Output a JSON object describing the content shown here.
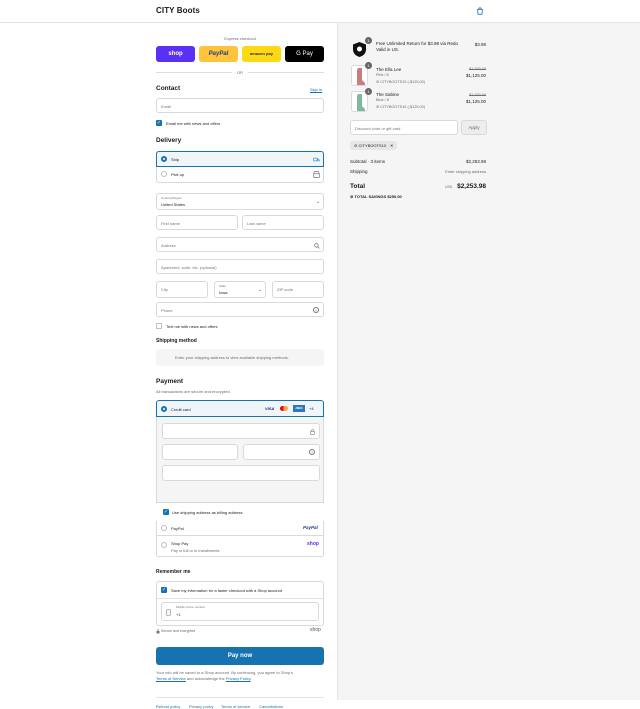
{
  "header": {
    "brand": "CITY Boots",
    "cart_icon": "shopping-bag-icon"
  },
  "express": {
    "title": "Express checkout",
    "buttons": [
      {
        "label": "shop",
        "color": "#5a31f4"
      },
      {
        "label": "PayPal",
        "color": "#ffc439"
      },
      {
        "label": "amazon pay",
        "color": "#ffd814"
      },
      {
        "label": "G Pay",
        "color": "#000000"
      }
    ],
    "or": "OR"
  },
  "contact": {
    "title": "Contact",
    "sign_in": "Sign in",
    "email_placeholder": "Email",
    "news_label": "Email me with news and offers"
  },
  "delivery": {
    "title": "Delivery",
    "options": [
      {
        "label": "Ship"
      },
      {
        "label": "Pick up"
      }
    ],
    "country_label": "Country/Region",
    "country_value": "United States",
    "first_name": "First name",
    "last_name": "Last name",
    "address": "Address",
    "apartment": "Apartment, suite, etc. (optional)",
    "city": "City",
    "state_label": "State",
    "state_value": "Iowa",
    "zip": "ZIP code",
    "phone": "Phone",
    "text_news": "Text me with news and offers"
  },
  "shipping_method": {
    "title": "Shipping method",
    "message": "Enter your shipping address to view available shipping methods."
  },
  "payment": {
    "title": "Payment",
    "subtitle": "All transactions are secure and encrypted.",
    "credit_card": "Credit card",
    "card_brands": [
      "VISA",
      "MC",
      "AMEX",
      "+4"
    ],
    "billing_label": "Use shipping address as billing address",
    "paypal_label": "PayPal",
    "paypal_logo": "PayPal",
    "shoppay_label": "Shop Pay",
    "shoppay_sub": "Pay in full or in installments",
    "shoppay_logo": "shop"
  },
  "remember": {
    "title": "Remember me",
    "save_label": "Save my information for a faster checkout with a Shop account",
    "mobile_label": "Mobile phone number",
    "mobile_value": "+1",
    "secure_label": "Secure and encrypted",
    "shop_logo": "shop"
  },
  "pay": {
    "button": "Pay now",
    "terms_1": "Your info will be saved to a Shop account. By continuing, you agree to Shop's",
    "terms_link1": "Terms of Service",
    "terms_mid": " and acknowledge the ",
    "terms_link2": "Privacy Policy",
    "terms_end": "."
  },
  "footer": {
    "links": [
      "Refund policy",
      "Privacy policy",
      "Terms of service",
      "Cancellations"
    ]
  },
  "cart": {
    "items": [
      {
        "name": "Free Unlimited Return for $3.98 via Redo Valid in US.",
        "qty": "1",
        "price": "$3.98"
      },
      {
        "name": "The Ella Lee",
        "variant": "Pink / 8",
        "discount": "CITYBOOTS10 (-$125.00)",
        "old_price": "$1,250.00",
        "price": "$1,125.00",
        "qty": "1"
      },
      {
        "name": "The Sabine",
        "variant": "Blue / 8",
        "discount": "CITYBOOTS10 (-$125.00)",
        "old_price": "$1,250.00",
        "price": "$1,125.00",
        "qty": "1"
      }
    ],
    "discount_placeholder": "Discount code or gift card",
    "apply": "Apply",
    "code_tag": "CITYBOOTS10",
    "subtotal_label": "Subtotal · 3 items",
    "subtotal_value": "$2,253.98",
    "shipping_label": "Shipping",
    "shipping_value": "Enter shipping address",
    "total_label": "Total",
    "currency": "USD",
    "total_value": "$2,253.98",
    "savings_label": "TOTAL SAVINGS",
    "savings_value": "$250.00"
  },
  "colors": {
    "accent": "#1773b0"
  }
}
